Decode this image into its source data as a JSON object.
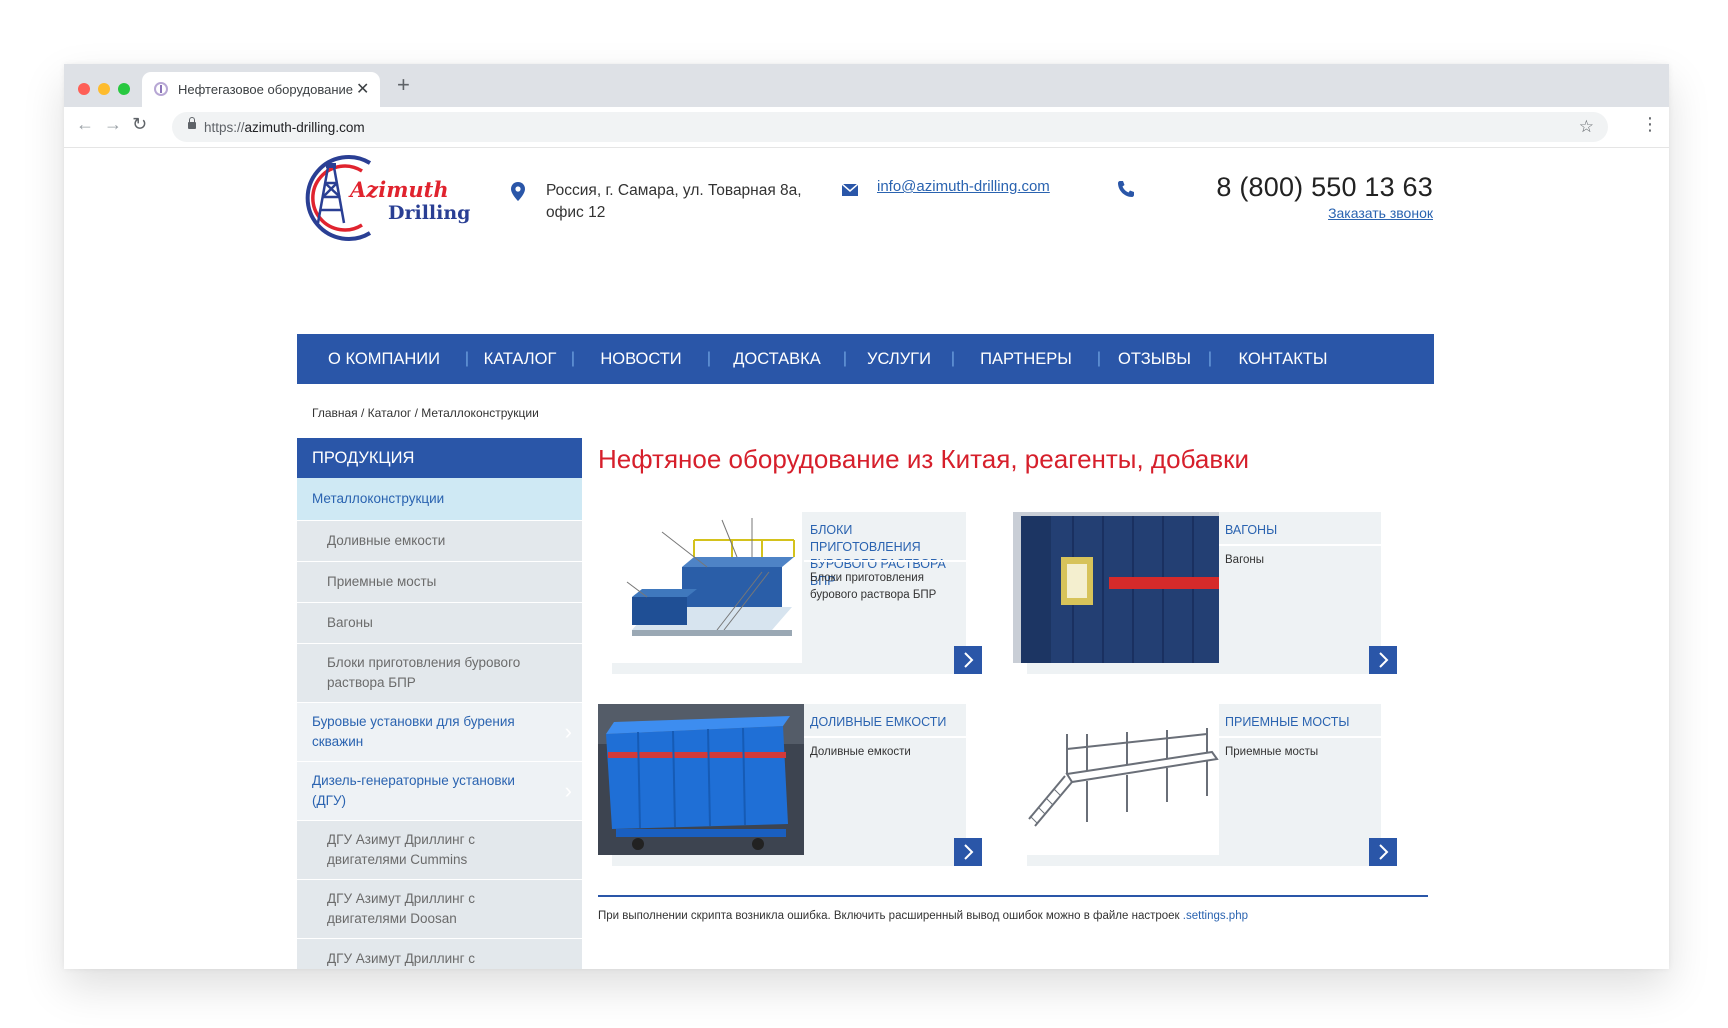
{
  "browser": {
    "tab_title": "Нефтегазовое оборудование",
    "url_scheme": "https://",
    "url_host": "azimuth-drilling.com"
  },
  "header": {
    "logo_line1": "Azimuth",
    "logo_line2": "Drilling",
    "address_line1": "Россия, г. Самара, ул. Товарная 8а,",
    "address_line2": "офис 12",
    "email": "info@azimuth-drilling.com",
    "phone": "8 (800) 550 13 63",
    "callback": "Заказать звонок"
  },
  "nav": [
    "О КОМПАНИИ",
    "КАТАЛОГ",
    "НОВОСТИ",
    "ДОСТАВКА",
    "УСЛУГИ",
    "ПАРТНЕРЫ",
    "ОТЗЫВЫ",
    "КОНТАКТЫ"
  ],
  "breadcrumb": "Главная / Каталог / Металлоконструкции",
  "sidebar": {
    "heading": "ПРОДУКЦИЯ",
    "items": [
      {
        "label": "Металлоконструкции",
        "kind": "active"
      },
      {
        "label": "Доливные емкости",
        "kind": "sub"
      },
      {
        "label": "Приемные мосты",
        "kind": "sub"
      },
      {
        "label": "Вагоны",
        "kind": "sub"
      },
      {
        "label": "Блоки приготовления бурового раствора БПР",
        "kind": "sub"
      },
      {
        "label": "Буровые установки для бурения скважин",
        "kind": "top"
      },
      {
        "label": "Дизель-генераторные установки (ДГУ)",
        "kind": "top"
      },
      {
        "label": "ДГУ Азимут Дриллинг с двигателями Cummins",
        "kind": "sub"
      },
      {
        "label": "ДГУ Азимут Дриллинг с двигателями Doosan",
        "kind": "sub"
      },
      {
        "label": "ДГУ Азимут Дриллинг с",
        "kind": "sub"
      }
    ]
  },
  "main": {
    "title": "Нефтяное оборудование из Китая, реагенты, добавки",
    "products": [
      {
        "title": "Блоки приготовления бурового раствора БПР",
        "desc": "Блоки приготовления бурового раствора БПР",
        "image": "mud-unit-diagram"
      },
      {
        "title": "Вагоны",
        "desc": "Вагоны",
        "image": "blue-wagon-photo"
      },
      {
        "title": "Доливные емкости",
        "desc": "Доливные емкости",
        "image": "blue-tank-photo"
      },
      {
        "title": "Приемные мосты",
        "desc": "Приемные мосты",
        "image": "bridge-render"
      }
    ],
    "error_text": "При выполнении скрипта возникла ошибка. Включить расширенный вывод ошибок можно в файле настроек ",
    "error_link": ".settings.php"
  },
  "colors": {
    "brand_blue": "#2a56a8",
    "title_red": "#d61f2b",
    "link_blue": "#2a63b0",
    "sidebar_active": "#cfe9f4"
  }
}
